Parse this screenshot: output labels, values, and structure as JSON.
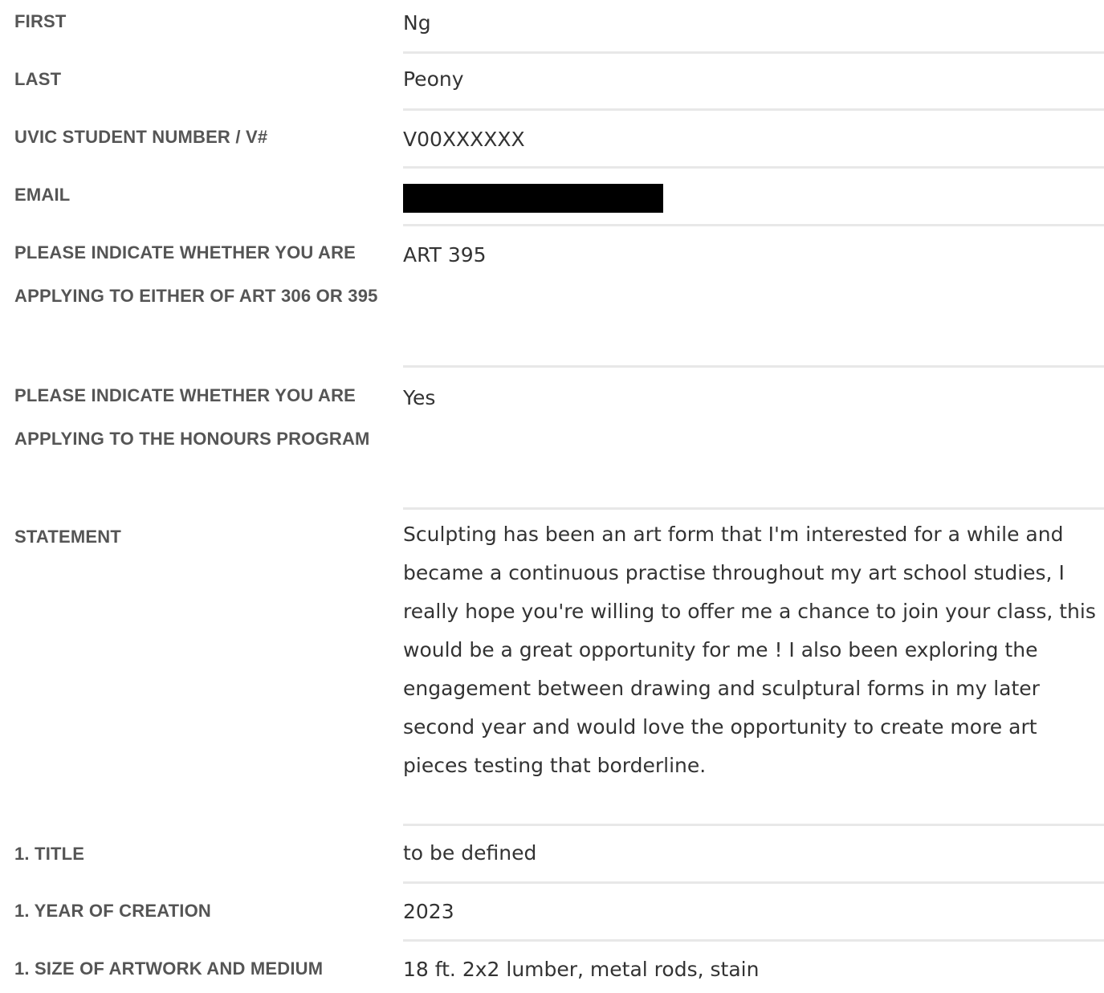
{
  "fields": [
    {
      "label": "FIRST",
      "value": "Ng"
    },
    {
      "label": "LAST",
      "value": "Peony"
    },
    {
      "label": "UVIC STUDENT NUMBER / V#",
      "value": "V00XXXXXX"
    },
    {
      "label": "EMAIL",
      "value": ""
    },
    {
      "label": "PLEASE INDICATE WHETHER YOU ARE APPLYING TO EITHER OF ART 306 OR 395",
      "value": "ART 395"
    },
    {
      "label": "PLEASE INDICATE WHETHER YOU ARE APPLYING TO THE HONOURS PROGRAM",
      "value": "Yes"
    },
    {
      "label": "STATEMENT",
      "value": "Sculpting has been an art form that I'm interested for a while and became a continuous practise throughout my art school studies, I really hope you're willing to offer me a chance to join your class, this would be a great opportunity for me ! I also been exploring the engagement between drawing and sculptural forms in my later second year and would love the opportunity to create more art pieces testing that borderline."
    },
    {
      "label": "1. TITLE",
      "value": "to be defined"
    },
    {
      "label": "1. YEAR OF CREATION",
      "value": "2023"
    },
    {
      "label": "1. SIZE OF ARTWORK AND MEDIUM",
      "value": "18 ft. 2x2 lumber, metal rods, stain"
    }
  ]
}
